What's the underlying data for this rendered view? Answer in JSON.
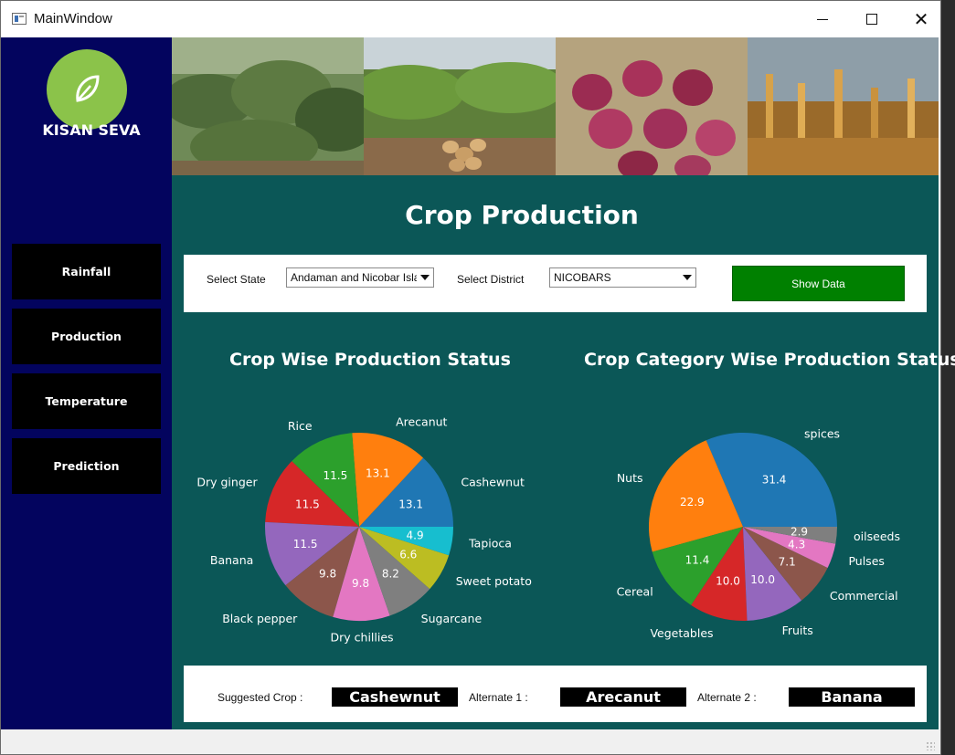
{
  "window": {
    "title": "MainWindow"
  },
  "sidebar": {
    "brand": "KISAN SEVA",
    "items": [
      {
        "label": "Rainfall"
      },
      {
        "label": "Production"
      },
      {
        "label": "Temperature"
      },
      {
        "label": "Prediction"
      }
    ]
  },
  "banner": {
    "images": [
      "cassava-plants",
      "potato-field",
      "red-onions",
      "wheat-field"
    ]
  },
  "main": {
    "title": "Crop Production",
    "filters": {
      "state_label": "Select State",
      "state_value": "Andaman and Nicobar Isla",
      "district_label": "Select District",
      "district_value": "NICOBARS",
      "show_button": "Show Data"
    },
    "results": {
      "suggested_label": "Suggested Crop :",
      "suggested_value": "Cashewnut",
      "alt1_label": "Alternate 1 :",
      "alt1_value": "Arecanut",
      "alt2_label": "Alternate 2 :",
      "alt2_value": "Banana"
    }
  },
  "colors": {
    "sidebar": "#03045e",
    "main_bg": "#0b5757",
    "button_green": "#008000",
    "logo_green": "#8bc34a"
  },
  "chart_data": [
    {
      "type": "pie",
      "title": "Crop Wise Production Status",
      "slices": [
        {
          "label": "Cashewnut",
          "value": 13.1,
          "color": "#1f77b4"
        },
        {
          "label": "Arecanut",
          "value": 13.1,
          "color": "#ff7f0e"
        },
        {
          "label": "Rice",
          "value": 11.5,
          "color": "#2ca02c"
        },
        {
          "label": "Dry ginger",
          "value": 11.5,
          "color": "#d62728"
        },
        {
          "label": "Banana",
          "value": 11.5,
          "color": "#9467bd"
        },
        {
          "label": "Black pepper",
          "value": 9.8,
          "color": "#8c564b"
        },
        {
          "label": "Dry chillies",
          "value": 9.8,
          "color": "#e377c2"
        },
        {
          "label": "Sugarcane",
          "value": 8.2,
          "color": "#7f7f7f"
        },
        {
          "label": "Sweet potato",
          "value": 6.6,
          "color": "#bcbd22"
        },
        {
          "label": "Tapioca",
          "value": 4.9,
          "color": "#17becf"
        }
      ]
    },
    {
      "type": "pie",
      "title": "Crop Category Wise Production Status",
      "slices": [
        {
          "label": "spices",
          "value": 31.4,
          "color": "#1f77b4"
        },
        {
          "label": "Nuts",
          "value": 22.9,
          "color": "#ff7f0e"
        },
        {
          "label": "Cereal",
          "value": 11.4,
          "color": "#2ca02c"
        },
        {
          "label": "Vegetables",
          "value": 10.0,
          "color": "#d62728"
        },
        {
          "label": "Fruits",
          "value": 10.0,
          "color": "#9467bd"
        },
        {
          "label": "Commercial",
          "value": 7.1,
          "color": "#8c564b"
        },
        {
          "label": "Pulses",
          "value": 4.3,
          "color": "#e377c2"
        },
        {
          "label": "oilseeds",
          "value": 2.9,
          "color": "#7f7f7f"
        }
      ]
    }
  ]
}
